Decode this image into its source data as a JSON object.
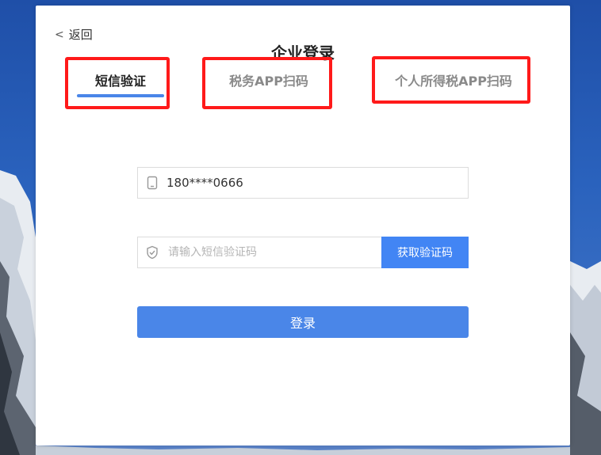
{
  "page": {
    "back_label": "返回",
    "title": "企业登录"
  },
  "tabs": [
    {
      "label": "短信验证",
      "active": true
    },
    {
      "label": "税务APP扫码",
      "active": false
    },
    {
      "label": "个人所得税APP扫码",
      "active": false
    }
  ],
  "form": {
    "phone_value": "180****0666",
    "code_placeholder": "请输入短信验证码",
    "get_code_label": "获取验证码",
    "login_label": "登录"
  },
  "colors": {
    "accent": "#4a86e8",
    "highlight": "#ff1a1a"
  },
  "icons": {
    "back": "chevron-left-icon",
    "phone": "phone-icon",
    "code": "shield-check-icon"
  }
}
